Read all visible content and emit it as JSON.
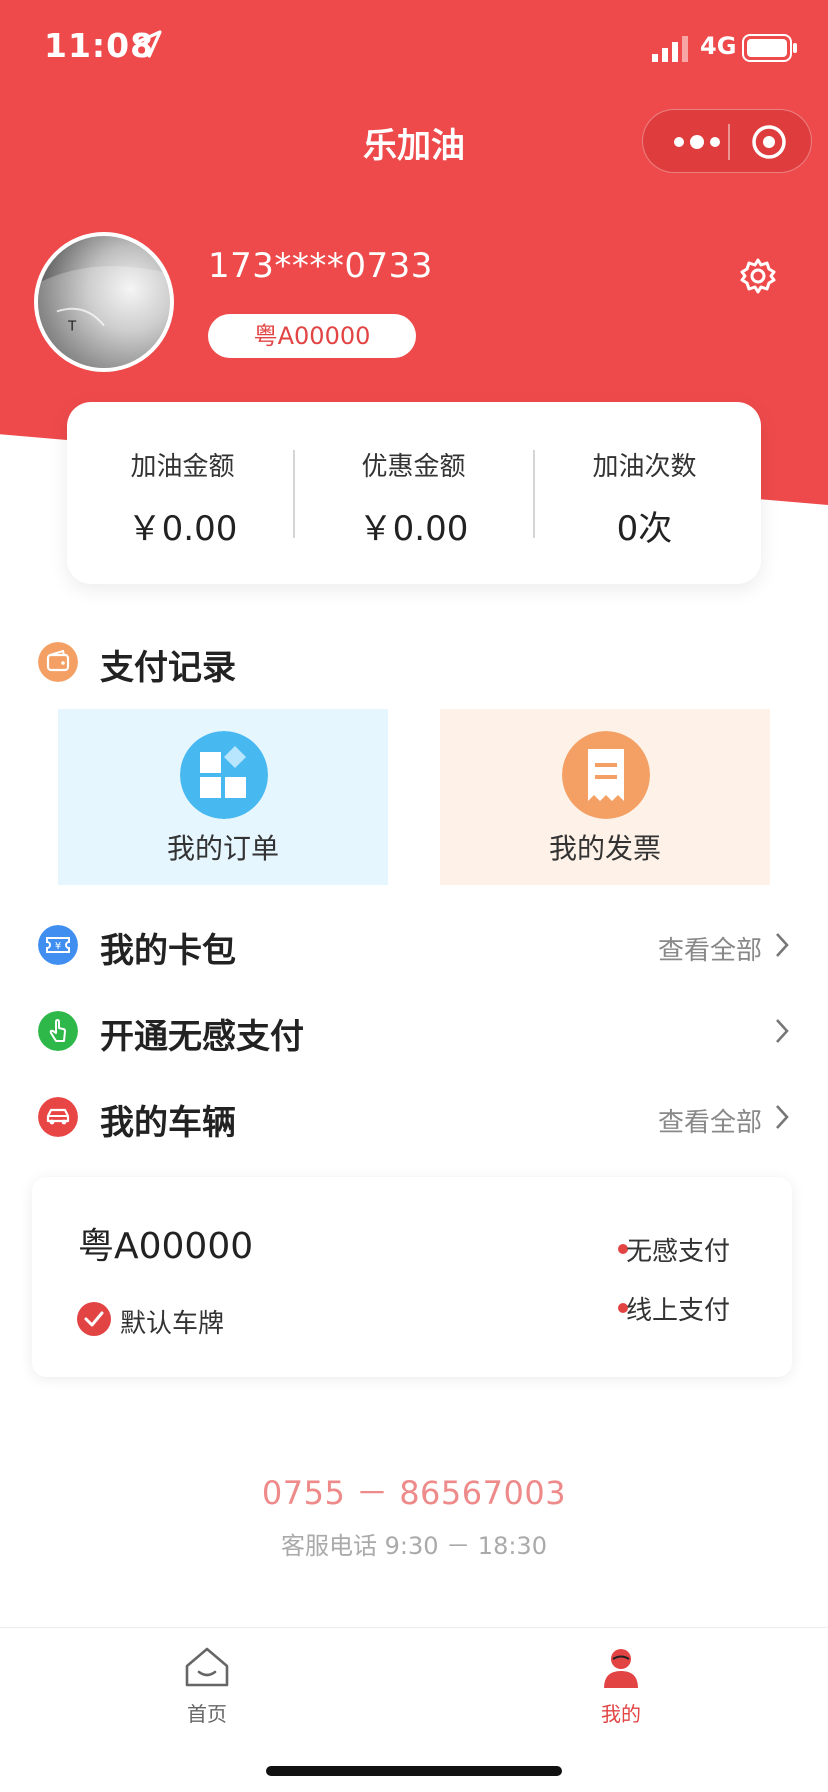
{
  "status_bar": {
    "time": "11:08",
    "network": "4G"
  },
  "nav": {
    "title": "乐加油"
  },
  "profile": {
    "phone": "173****0733",
    "plate": "粤A00000"
  },
  "stats": [
    {
      "label": "加油金额",
      "value": "￥0.00"
    },
    {
      "label": "优惠金额",
      "value": "￥0.00"
    },
    {
      "label": "加油次数",
      "value": "0次"
    }
  ],
  "payment_records": {
    "title": "支付记录",
    "tiles": [
      {
        "label": "我的订单"
      },
      {
        "label": "我的发票"
      }
    ]
  },
  "card_wallet": {
    "title": "我的卡包",
    "view_all": "查看全部"
  },
  "contactless_pay": {
    "title": "开通无感支付"
  },
  "vehicles": {
    "title": "我的车辆",
    "view_all": "查看全部",
    "card": {
      "plate": "粤A00000",
      "default_label": "默认车牌",
      "payment_methods": [
        "无感支付",
        "线上支付"
      ]
    }
  },
  "support": {
    "hotline": "0755 － 86567003",
    "hours": "客服电话 9:30 － 18:30"
  },
  "tabbar": {
    "tabs": [
      {
        "label": "首页",
        "active": false
      },
      {
        "label": "我的",
        "active": true
      }
    ]
  },
  "colors": {
    "brand_red": "#ee4a4b",
    "wallet_blue": "#3f8ef0",
    "nfc_green": "#2eb84a",
    "order_blue": "#48b8f1",
    "invoice_orange": "#f4a064"
  },
  "icons": {
    "status_location": "location-arrow-icon",
    "settings": "gear-icon",
    "payment_records": "wallet-icon",
    "orders": "grid-icon",
    "invoices": "receipt-icon",
    "card_wallet": "ticket-icon",
    "contactless_pay": "tap-finger-icon",
    "vehicles": "car-icon",
    "tab_home": "home-icon",
    "tab_mine": "person-icon"
  }
}
